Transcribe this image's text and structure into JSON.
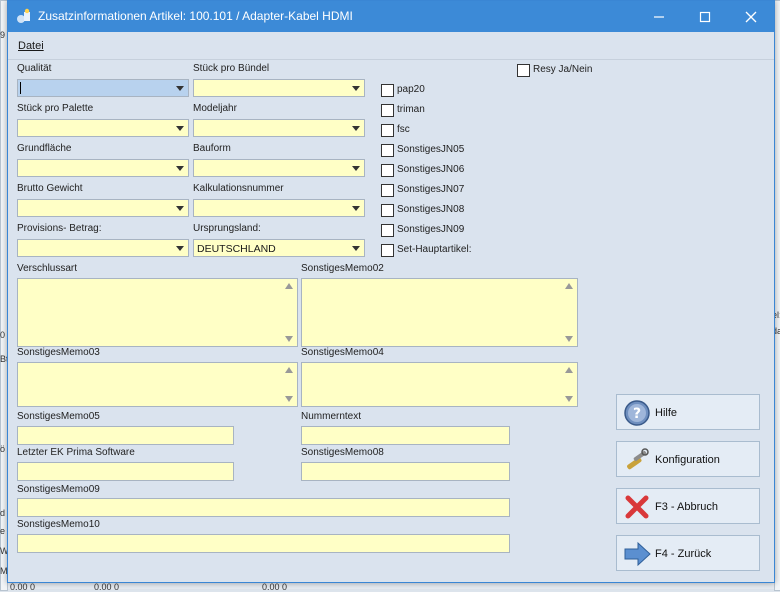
{
  "window": {
    "title": "Zusatzinformationen Artikel: 100.101 / Adapter-Kabel HDMI"
  },
  "menu": {
    "datei": "Datei"
  },
  "fields": {
    "qualitaet": "Qualität",
    "stueck_pro_buendel": "Stück pro Bündel",
    "stueck_pro_palette": "Stück pro Palette",
    "modeljahr": "Modeljahr",
    "grundflaeche": "Grundfläche",
    "bauform": "Bauform",
    "brutto_gewicht": "Brutto Gewicht",
    "kalkulationsnummer": "Kalkulationsnummer",
    "provisions_betrag": "Provisions- Betrag:",
    "ursprungsland": "Ursprungsland:",
    "ursprungsland_value": "DEUTSCHLAND"
  },
  "checkboxes": {
    "resy": "Resy Ja/Nein",
    "pap20": "pap20",
    "triman": "triman",
    "fsc": "fsc",
    "jn05": "SonstigesJN05",
    "jn06": "SonstigesJN06",
    "jn07": "SonstigesJN07",
    "jn08": "SonstigesJN08",
    "jn09": "SonstigesJN09",
    "set_hauptartikel": "Set-Hauptartikel:"
  },
  "memos": {
    "verschlussart": "Verschlussart",
    "memo02": "SonstigesMemo02",
    "memo03": "SonstigesMemo03",
    "memo04": "SonstigesMemo04"
  },
  "texts": {
    "memo05": "SonstigesMemo05",
    "nummerntext": "Nummerntext",
    "letzter_ek": "Letzter EK Prima Software",
    "memo08": "SonstigesMemo08",
    "memo09": "SonstigesMemo09",
    "memo10": "SonstigesMemo10"
  },
  "buttons": {
    "hilfe": "Hilfe",
    "konfiguration": "Konfiguration",
    "abbruch": "F3 - Abbruch",
    "zurueck": "F4 - Zurück"
  },
  "background_fragments": {
    "a": "el:",
    "b": "da",
    "c": "0",
    "d": "Bt",
    "e": "ö",
    "f": "d",
    "g": "e",
    "h": "W",
    "i": "M",
    "j": "9",
    "k": "0.00 0",
    "l": "0.00 0",
    "m": "0.00 0"
  },
  "colors": {
    "titlebar": "#3c8ad7",
    "field_bg": "#ffffc6",
    "window_bg": "#dae3ee"
  }
}
